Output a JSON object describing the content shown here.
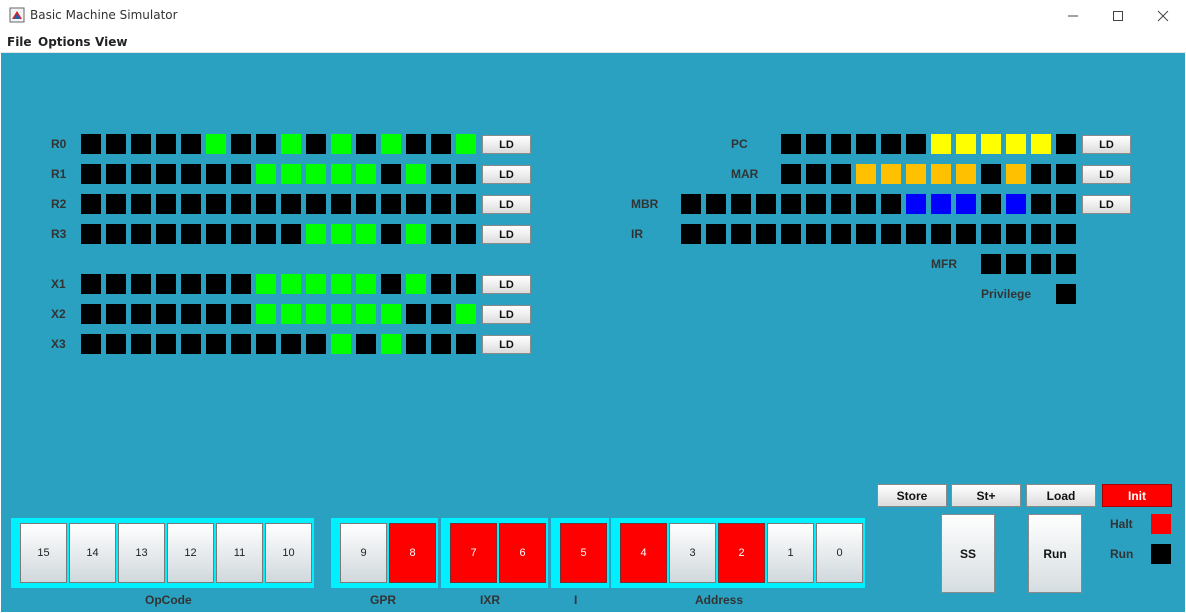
{
  "window": {
    "title": "Basic Machine Simulator"
  },
  "menu": [
    "File",
    "Options",
    "View"
  ],
  "colors": {
    "panel": "#2aa1c1",
    "off": "#000000",
    "gpr_on": "#00ff00",
    "pc_on": "#ffff00",
    "mar_on": "#ffc000",
    "mbr_on": "#0000ff",
    "switch_group": "#00f0ff",
    "switch_on": "#ff0000",
    "halt": "#ff0000",
    "run": "#000000"
  },
  "left_registers": [
    {
      "label": "R0",
      "bits": [
        0,
        0,
        0,
        0,
        0,
        1,
        0,
        0,
        1,
        0,
        1,
        0,
        1,
        0,
        0,
        1
      ],
      "ld": "LD"
    },
    {
      "label": "R1",
      "bits": [
        0,
        0,
        0,
        0,
        0,
        0,
        0,
        1,
        1,
        1,
        1,
        1,
        0,
        1,
        0,
        0
      ],
      "ld": "LD"
    },
    {
      "label": "R2",
      "bits": [
        0,
        0,
        0,
        0,
        0,
        0,
        0,
        0,
        0,
        0,
        0,
        0,
        0,
        0,
        0,
        0
      ],
      "ld": "LD"
    },
    {
      "label": "R3",
      "bits": [
        0,
        0,
        0,
        0,
        0,
        0,
        0,
        0,
        0,
        1,
        1,
        1,
        0,
        1,
        0,
        0
      ],
      "ld": "LD"
    },
    {
      "label": "X1",
      "bits": [
        0,
        0,
        0,
        0,
        0,
        0,
        0,
        1,
        1,
        1,
        1,
        1,
        0,
        1,
        0,
        0
      ],
      "ld": "LD"
    },
    {
      "label": "X2",
      "bits": [
        0,
        0,
        0,
        0,
        0,
        0,
        0,
        1,
        1,
        1,
        1,
        1,
        1,
        0,
        0,
        1
      ],
      "ld": "LD"
    },
    {
      "label": "X3",
      "bits": [
        0,
        0,
        0,
        0,
        0,
        0,
        0,
        0,
        0,
        0,
        1,
        0,
        1,
        0,
        0,
        0
      ],
      "ld": "LD"
    }
  ],
  "right_registers": [
    {
      "label": "PC",
      "bits": [
        0,
        0,
        0,
        0,
        0,
        0,
        1,
        1,
        1,
        1,
        1,
        0
      ],
      "ld": "LD",
      "color": "pc_on"
    },
    {
      "label": "MAR",
      "bits": [
        0,
        0,
        0,
        1,
        1,
        1,
        1,
        1,
        0,
        1,
        0,
        0
      ],
      "ld": "LD",
      "color": "mar_on"
    },
    {
      "label": "MBR",
      "bits": [
        0,
        0,
        0,
        0,
        0,
        0,
        0,
        0,
        0,
        1,
        1,
        1,
        0,
        1,
        0,
        0
      ],
      "ld": "LD",
      "color": "mbr_on"
    },
    {
      "label": "IR",
      "bits": [
        0,
        0,
        0,
        0,
        0,
        0,
        0,
        0,
        0,
        0,
        0,
        0,
        0,
        0,
        0,
        0
      ],
      "ld": "",
      "color": "gpr_on"
    },
    {
      "label": "MFR",
      "bits": [
        0,
        0,
        0,
        0
      ],
      "ld": "",
      "color": "gpr_on"
    },
    {
      "label": "Privilege",
      "bits": [
        0
      ],
      "ld": "",
      "color": "gpr_on"
    }
  ],
  "switch_groups": [
    {
      "label": "OpCode",
      "switches": [
        {
          "n": "15",
          "on": false
        },
        {
          "n": "14",
          "on": false
        },
        {
          "n": "13",
          "on": false
        },
        {
          "n": "12",
          "on": false
        },
        {
          "n": "11",
          "on": false
        },
        {
          "n": "10",
          "on": false
        }
      ]
    },
    {
      "label": "GPR",
      "switches": [
        {
          "n": "9",
          "on": false
        },
        {
          "n": "8",
          "on": true
        }
      ]
    },
    {
      "label": "IXR",
      "switches": [
        {
          "n": "7",
          "on": true
        },
        {
          "n": "6",
          "on": true
        }
      ]
    },
    {
      "label": "I",
      "switches": [
        {
          "n": "5",
          "on": true
        }
      ]
    },
    {
      "label": "Address",
      "switches": [
        {
          "n": "4",
          "on": true
        },
        {
          "n": "3",
          "on": false
        },
        {
          "n": "2",
          "on": true
        },
        {
          "n": "1",
          "on": false
        },
        {
          "n": "0",
          "on": false
        }
      ]
    }
  ],
  "controls": {
    "store": "Store",
    "st_plus": "St+",
    "load": "Load",
    "init": "Init",
    "ss": "SS",
    "run": "Run"
  },
  "indicators": {
    "halt": "Halt",
    "run": "Run"
  }
}
